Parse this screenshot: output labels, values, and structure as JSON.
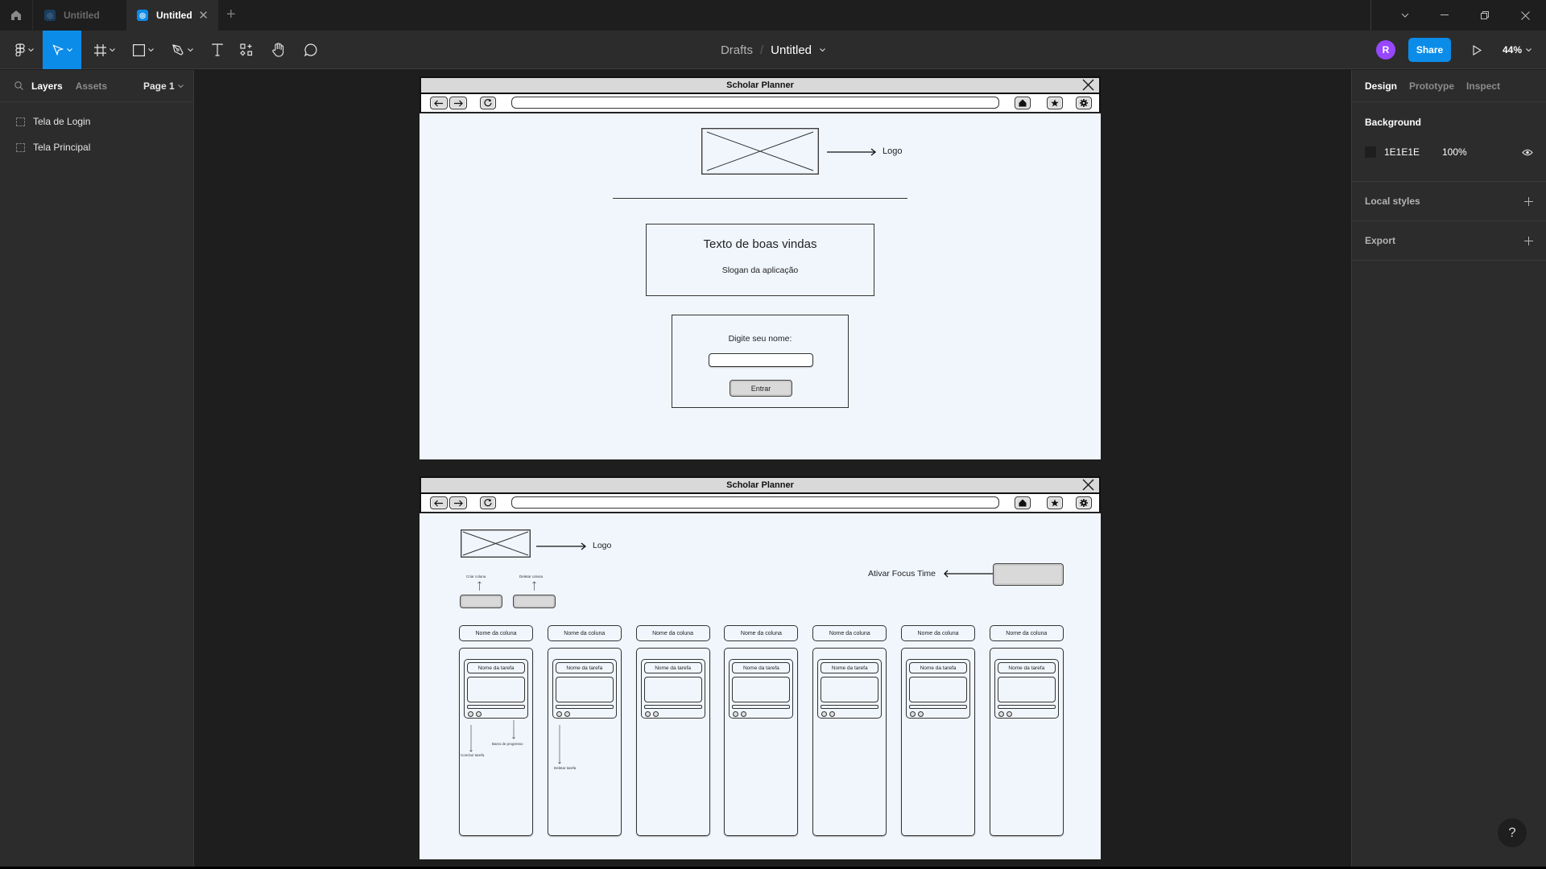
{
  "app": {
    "tabs": [
      {
        "label": "Untitled",
        "active": false
      },
      {
        "label": "Untitled",
        "active": true
      }
    ],
    "new_tab_label": "+",
    "accent_color": "#0c8ce9",
    "avatar_color": "#9747ff"
  },
  "toolbar": {
    "breadcrumb": {
      "folder": "Drafts",
      "separator": "/",
      "file": "Untitled"
    },
    "avatar_initial": "R",
    "share_label": "Share",
    "zoom_level": "44%",
    "tools": [
      "main-menu",
      "move",
      "frame",
      "shape",
      "pen",
      "text",
      "resources",
      "hand",
      "comment"
    ]
  },
  "left_panel": {
    "tabs": {
      "layers": "Layers",
      "assets": "Assets"
    },
    "page_selector": "Page 1",
    "layers": [
      {
        "name": "Tela de Login"
      },
      {
        "name": "Tela Principal"
      }
    ]
  },
  "right_panel": {
    "tabs": [
      "Design",
      "Prototype",
      "Inspect"
    ],
    "active_tab": "Design",
    "background": {
      "title": "Background",
      "hex": "1E1E1E",
      "opacity": "100%"
    },
    "local_styles": "Local styles",
    "export": "Export",
    "help": "?"
  },
  "frames": {
    "login": {
      "window_title": "Scholar Planner",
      "logo_label": "Logo",
      "welcome_text": "Texto de boas vindas",
      "slogan": "Slogan da aplicação",
      "name_prompt": "Digite seu nome:",
      "name_input_value": "",
      "enter_button": "Entrar"
    },
    "main": {
      "window_title": "Scholar Planner",
      "logo_label": "Logo",
      "create_column_label": "Criar coluna",
      "delete_column_label": "Deletar coluna",
      "focus_time_label": "Ativar Focus Time",
      "column_header": "Nome da coluna",
      "task_title": "Nome da tarefa",
      "column_count": 7,
      "annotations": {
        "complete_task": "Concluir tarefa",
        "progress_bar": "Barra de progresso",
        "delete_task": "Deletar tarefa"
      }
    }
  }
}
